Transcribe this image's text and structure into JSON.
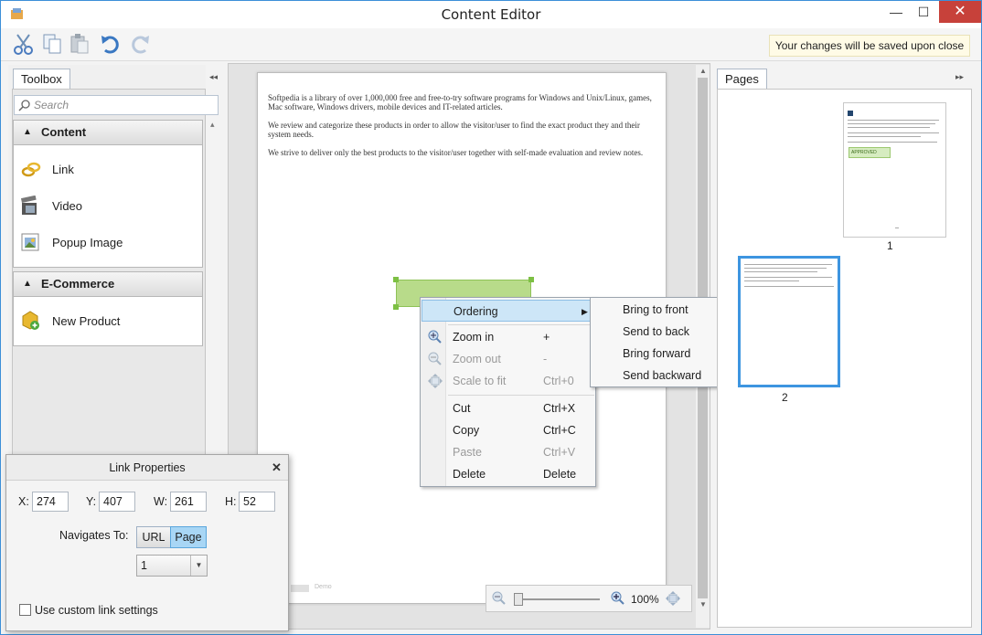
{
  "window": {
    "title": "Content Editor",
    "minimize": "—",
    "maximize": "☐",
    "close": "✕"
  },
  "toolbar": {
    "save_notice": "Your changes will be saved upon close"
  },
  "toolbox": {
    "tab_label": "Toolbox",
    "collapse": "◂◂",
    "search_placeholder": "Search",
    "scroll_up": "▴",
    "groups": [
      {
        "header": "Content",
        "items": [
          {
            "label": "Link",
            "icon": "link-icon"
          },
          {
            "label": "Video",
            "icon": "video-icon"
          },
          {
            "label": "Popup Image",
            "icon": "popup-image-icon"
          }
        ]
      },
      {
        "header": "E-Commerce",
        "items": [
          {
            "label": "New Product",
            "icon": "new-product-icon"
          }
        ]
      }
    ]
  },
  "document": {
    "paragraphs": [
      "Softpedia is a library of over 1,000,000 free and free-to-try software programs for Windows and Unix/Linux, games, Mac software, Windows drivers, mobile devices and IT-related articles.",
      "We review and categorize these products in order to allow the visitor/user to find the exact product they and their system needs.",
      "We strive to deliver only the best products to the visitor/user together with self-made evaluation and review notes."
    ],
    "footer_text": "Demo"
  },
  "context_menu": {
    "ordering": "Ordering",
    "zoom_in": "Zoom in",
    "zoom_in_sc": "+",
    "zoom_out": "Zoom out",
    "zoom_out_sc": "-",
    "scale_fit": "Scale to fit",
    "scale_fit_sc": "Ctrl+0",
    "cut": "Cut",
    "cut_sc": "Ctrl+X",
    "copy": "Copy",
    "copy_sc": "Ctrl+C",
    "paste": "Paste",
    "paste_sc": "Ctrl+V",
    "delete": "Delete",
    "delete_sc": "Delete"
  },
  "submenu": [
    "Bring to front",
    "Send to back",
    "Bring forward",
    "Send backward"
  ],
  "pages": {
    "tab_label": "Pages",
    "expand": "▸▸",
    "thumbs": [
      {
        "number": "1",
        "stamp": "APPROVED"
      },
      {
        "number": "2"
      }
    ]
  },
  "link_properties": {
    "title": "Link Properties",
    "close": "✕",
    "x_label": "X:",
    "x": "274",
    "y_label": "Y:",
    "y": "407",
    "w_label": "W:",
    "w": "261",
    "h_label": "H:",
    "h": "52",
    "navigates_label": "Navigates To:",
    "url_btn": "URL",
    "page_btn": "Page",
    "page_select": "1",
    "custom_label": "Use custom link settings"
  },
  "zoom": {
    "level": "100%"
  },
  "colors": {
    "accent": "#3c8fd8",
    "close": "#c7413a",
    "selection": "#8ec257",
    "menu_highlight": "#cde6f7"
  }
}
